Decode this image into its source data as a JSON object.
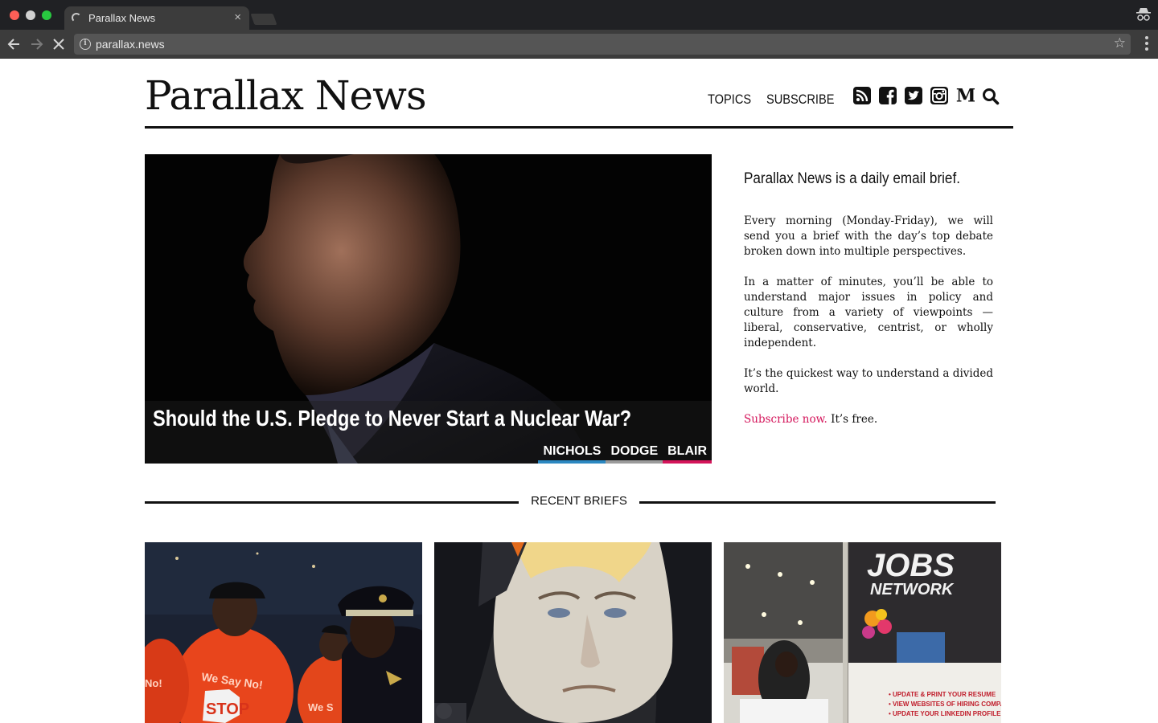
{
  "browser": {
    "tab_title": "Parallax News",
    "tab_close": "×",
    "url": "parallax.news"
  },
  "site": {
    "logo": "Parallax News",
    "nav": [
      "TOPICS",
      "SUBSCRIBE"
    ],
    "social_icons": [
      "rss-icon",
      "facebook-icon",
      "twitter-icon",
      "instagram-icon",
      "medium-icon",
      "search-icon"
    ]
  },
  "hero": {
    "title": "Should the U.S. Pledge to Never Start a Nuclear War?",
    "authors": [
      {
        "name": "NICHOLS",
        "color": "#2c88c1"
      },
      {
        "name": "DODGE",
        "color": "#9b9b9b"
      },
      {
        "name": "BLAIR",
        "color": "#d4145a"
      }
    ]
  },
  "promo": {
    "headline": "Parallax News is a daily email brief.",
    "p1": "Every morning (Monday-Friday), we will send you a brief with the day’s top debate broken down into multiple perspectives.",
    "p2": "In a matter of minutes, you’ll be able to understand major issues in policy and culture from a variety of viewpoints — liberal, conservative, centrist, or wholly independent.",
    "p3": "It’s the quickest way to understand a divided world.",
    "cta_link": "Subscribe now.",
    "cta_tail": " It’s free."
  },
  "recent": {
    "label": "RECENT BRIEFS",
    "photo_texts": {
      "b1_shirt": "We Say No!",
      "b1_stop": "STOP",
      "b1_shirt2": "We S",
      "b1_side": "No!",
      "b3_sign_1": "JOBS",
      "b3_sign_2": "NETWORK",
      "b3_list": [
        "• UPDATE & PRINT YOUR RESUME",
        "• VIEW WEBSITES OF HIRING COMPA",
        "• UPDATE YOUR LINKEDIN PROFILE"
      ]
    }
  }
}
